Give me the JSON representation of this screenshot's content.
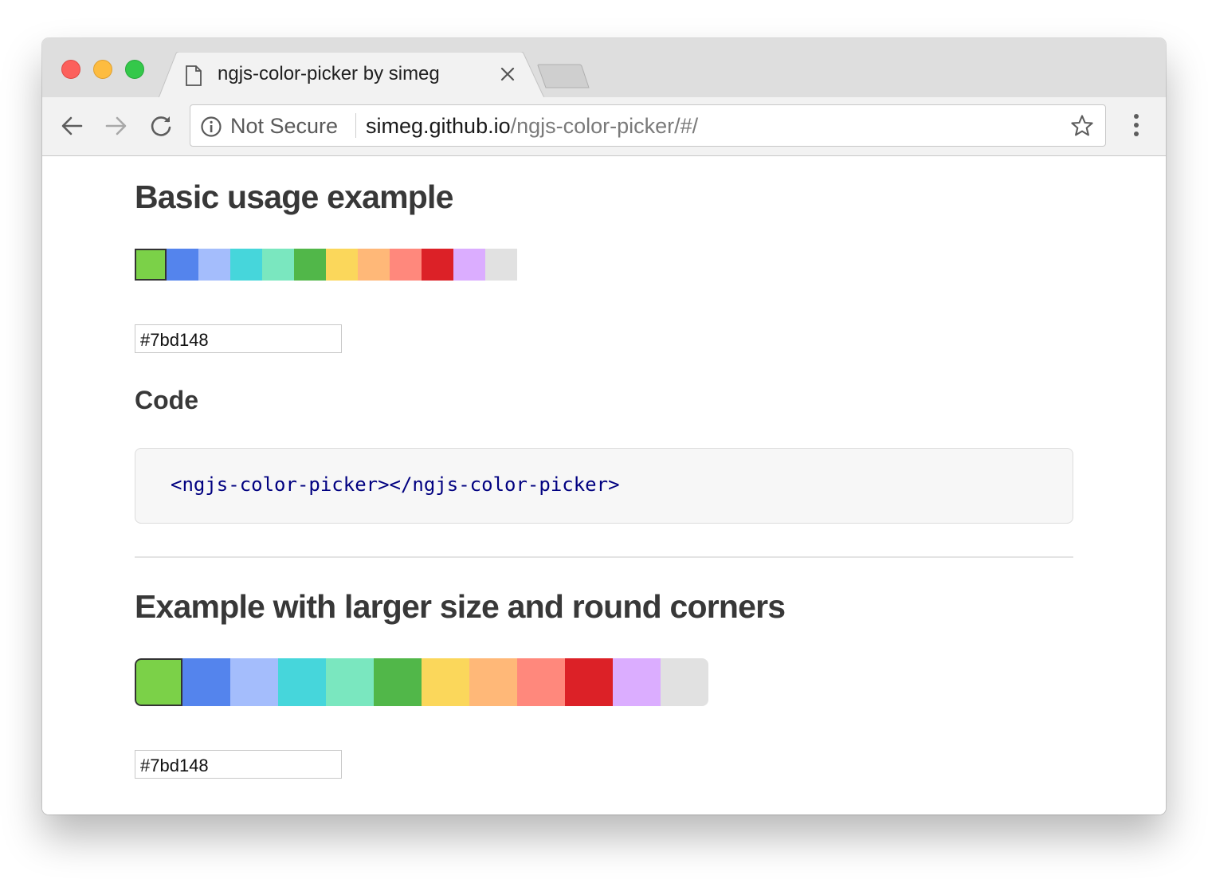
{
  "browser": {
    "tab_title": "ngjs-color-picker by simeg",
    "security_label": "Not Secure",
    "url_host": "simeg.github.io",
    "url_path": "/ngjs-color-picker/#/"
  },
  "sections": {
    "basic": {
      "heading": "Basic usage example",
      "input_value": "#7bd148",
      "code_heading": "Code",
      "code": "<ngjs-color-picker></ngjs-color-picker>"
    },
    "larger": {
      "heading": "Example with larger size and round corners",
      "input_value": "#7bd148"
    }
  },
  "palette": {
    "selected": "#7bd148",
    "colors": [
      "#7bd148",
      "#5484ed",
      "#a4bdfc",
      "#46d6db",
      "#7ae7bf",
      "#51b749",
      "#fbd75b",
      "#ffb878",
      "#ff887c",
      "#dc2127",
      "#dbadff",
      "#e1e1e1"
    ]
  },
  "icons": {
    "page": "page-icon",
    "close": "close-icon",
    "back": "back-arrow-icon",
    "forward": "forward-arrow-icon",
    "reload": "reload-icon",
    "info": "info-icon",
    "star": "star-icon",
    "menu": "more-vertical-icon"
  }
}
